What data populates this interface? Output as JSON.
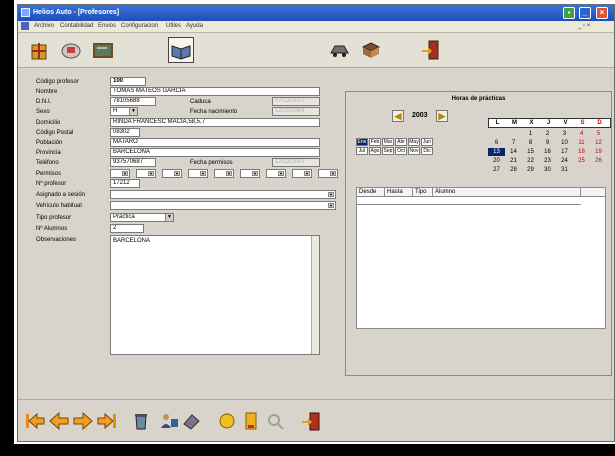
{
  "window": {
    "title": "Helios Auto - [Profesores]"
  },
  "menu": [
    "Archivo",
    "Contabilidad",
    "Envios",
    "Configuracion",
    "Utiles",
    "Ayuda"
  ],
  "toolbar": {
    "icons": [
      "gift-box-icon",
      "mail-stamp-icon",
      "chalkboard-icon",
      "open-book-icon",
      "car-keys-icon",
      "book-icon",
      "exit-door-icon"
    ]
  },
  "form": {
    "codigo": {
      "label": "Código profesor",
      "value": "100"
    },
    "nombre": {
      "label": "Nombre",
      "value": "TOMAS MATEOS GARCIA"
    },
    "dni": {
      "label": "D.N.I.",
      "value": "78105688",
      "caduca_label": "Caduca",
      "caduca_value": "07/12/2007"
    },
    "sexo": {
      "label": "Sexo",
      "value": "H"
    },
    "fecha_nacimiento": {
      "label": "Fecha nacimiento",
      "value": "12/11/1964"
    },
    "domicilio": {
      "label": "Domicilio",
      "value": "RINDA FRANCESC MACIA,58,5,7"
    },
    "codigo_postal": {
      "label": "Código Postal",
      "value": "08302"
    },
    "poblacion": {
      "label": "Población",
      "value": "MATARO"
    },
    "provincia": {
      "label": "Provincia",
      "value": "BARCELONA"
    },
    "telefono": {
      "label": "Teléfono",
      "value": "937570687",
      "fecha_permisos_label": "Fecha permisos",
      "fecha_permisos_value": "12/12/2007"
    },
    "permisos": {
      "label": "Permisos"
    },
    "num_profesor": {
      "label": "Nº profesor",
      "value": "17212"
    },
    "asignado": {
      "label": "Asignado a sesión"
    },
    "vehiculo": {
      "label": "Vehículo habitual"
    },
    "tipo": {
      "label": "Tipo profesor",
      "value": "Práctica"
    },
    "alumnos": {
      "label": "Nº Alumnos",
      "value": "2"
    },
    "observaciones": {
      "label": "Observaciones",
      "value": "BARCELONA"
    }
  },
  "practicas": {
    "title": "Horas de prácticas",
    "year": "2003",
    "months": [
      "Ene",
      "Feb",
      "Mar",
      "Abr",
      "May",
      "Jun",
      "Jul",
      "Ago",
      "Sep",
      "Oct",
      "Nov",
      "Dic"
    ],
    "day_headers": [
      "L",
      "M",
      "X",
      "J",
      "V",
      "S",
      "D"
    ],
    "weeks": [
      [
        "",
        "",
        "1",
        "2",
        "3",
        "4",
        "5"
      ],
      [
        "6",
        "7",
        "8",
        "9",
        "10",
        "11",
        "12"
      ],
      [
        "13",
        "14",
        "15",
        "16",
        "17",
        "18",
        "19"
      ],
      [
        "20",
        "21",
        "22",
        "23",
        "24",
        "25",
        "26"
      ],
      [
        "27",
        "28",
        "29",
        "30",
        "31",
        "",
        ""
      ]
    ],
    "today": "13",
    "columns": [
      "Desde",
      "Hasta",
      "Tipo",
      "Alumno"
    ]
  },
  "nav": {
    "icons": [
      "first-record-icon",
      "previous-record-icon",
      "next-record-icon",
      "last-record-icon",
      "trash-icon",
      "edit-user-icon",
      "eraser-icon",
      "add-icon",
      "clipboard-icon",
      "search-icon",
      "exit-door-icon"
    ]
  }
}
